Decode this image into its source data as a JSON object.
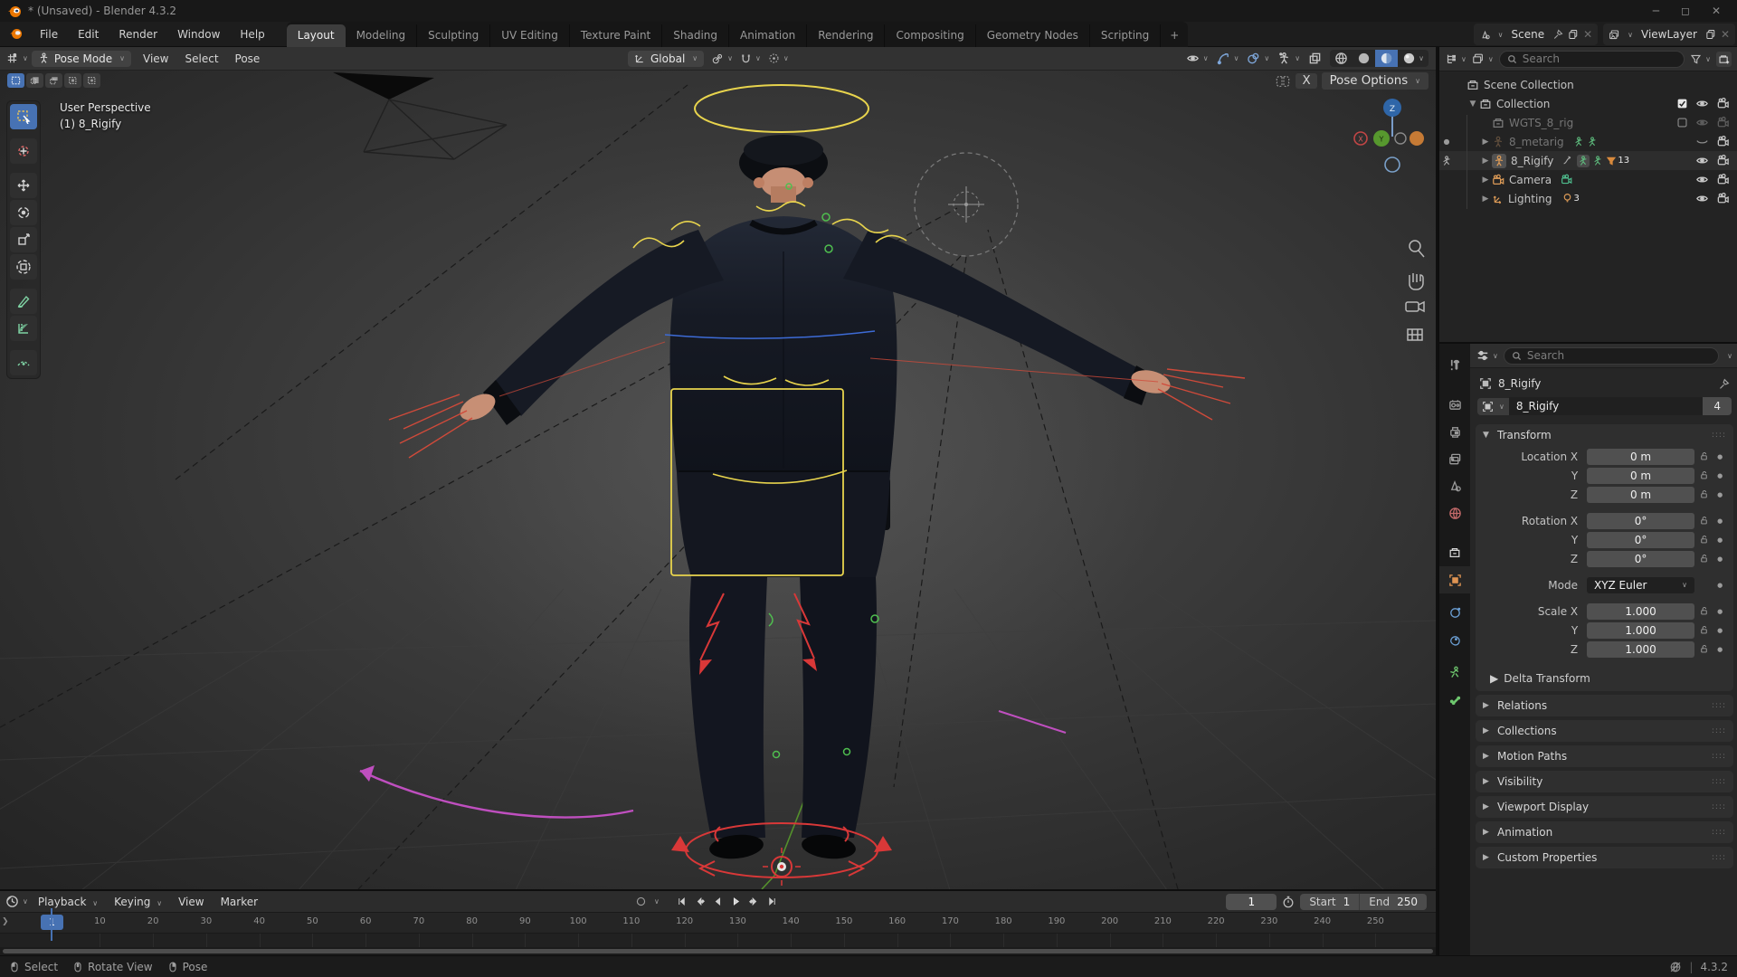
{
  "colors": {
    "accent": "#4772b3",
    "object_orange": "#e09553",
    "data_green": "#6ec76e",
    "rig_yellow": "#e8d44d",
    "rig_red": "#d93838",
    "rig_green": "#4fbf4f",
    "rig_magenta": "#bf4fbf",
    "axis_x": "#c94545",
    "axis_y": "#57982e",
    "axis_z": "#3f6fb8"
  },
  "window": {
    "title": "* (Unsaved) - Blender 4.3.2",
    "controls": [
      "minimize",
      "maximize",
      "close"
    ]
  },
  "topbar": {
    "menus": [
      "File",
      "Edit",
      "Render",
      "Window",
      "Help"
    ],
    "workspaces": [
      "Layout",
      "Modeling",
      "Sculpting",
      "UV Editing",
      "Texture Paint",
      "Shading",
      "Animation",
      "Rendering",
      "Compositing",
      "Geometry Nodes",
      "Scripting"
    ],
    "active_workspace": "Layout",
    "add_workspace": "+",
    "scene": {
      "icon": "scene-browse",
      "label": "Scene",
      "icons": [
        "pin",
        "copy",
        "close-x"
      ]
    },
    "viewlayer": {
      "icon": "viewlayer",
      "label": "ViewLayer",
      "icons": [
        "copy",
        "close-x"
      ]
    }
  },
  "viewport": {
    "header": {
      "editor_icon": "editor-3d",
      "mode_icon": "pose-figure",
      "mode": "Pose Mode",
      "menus": [
        "View",
        "Select",
        "Pose"
      ],
      "orientation": "Global",
      "center_icons": [
        "orientation",
        "pivot",
        "magnet",
        "proportional"
      ],
      "right_icons": [
        {
          "name": "visibility-eye",
          "active": false
        },
        {
          "name": "gizmo",
          "active": true
        },
        {
          "name": "overlays",
          "active": true
        },
        {
          "name": "xray-figure",
          "active": false
        },
        {
          "name": "xray-squares",
          "active": false,
          "caret": false
        }
      ],
      "shading_modes": [
        {
          "name": "wireframe",
          "active": false
        },
        {
          "name": "solid",
          "active": false
        },
        {
          "name": "material",
          "active": true
        },
        {
          "name": "rendered",
          "active": false,
          "caret": true
        }
      ],
      "select_modes": [
        "set",
        "extend",
        "subtract",
        "invert",
        "intersect"
      ],
      "mirror_icon": "butterfly",
      "mirror_x": "X",
      "pose_options": "Pose Options"
    },
    "overlay_text": [
      "User Perspective",
      "(1) 8_Rigify"
    ],
    "gizmo_axes": {
      "x": "X",
      "y": "Y",
      "z": "Z"
    },
    "nav_buttons": [
      "zoom",
      "hand",
      "camera",
      "grid"
    ],
    "tools": [
      "select-box",
      "cursor",
      "move",
      "rotate",
      "scale",
      "transform",
      "annotate",
      "measure",
      "breakdowner"
    ]
  },
  "outliner": {
    "header_icons": [
      "filter-tree",
      "display-mode"
    ],
    "search_placeholder": "Search",
    "right_icons": [
      "funnel",
      "new-collection"
    ],
    "rows": [
      {
        "label": "Scene Collection",
        "icon": "collection",
        "indent": 0,
        "expander": "",
        "gutter": "",
        "dim": false,
        "sel": false,
        "inline": [],
        "badge": "",
        "toggles": []
      },
      {
        "label": "Collection",
        "icon": "collection",
        "indent": 1,
        "expander": "down",
        "gutter": "",
        "dim": false,
        "sel": false,
        "inline": [],
        "badge": "",
        "toggles": [
          "checkbox-on",
          "eye",
          "camera"
        ]
      },
      {
        "label": "WGTS_8_rig",
        "icon": "collection",
        "indent": 2,
        "expander": "",
        "gutter": "",
        "dim": true,
        "sel": false,
        "inline": [],
        "badge": "",
        "toggles": [
          "checkbox-off",
          "eye-dim",
          "camera-x"
        ]
      },
      {
        "label": "8_metarig",
        "icon": "armature",
        "indent": 2,
        "expander": "right",
        "gutter": "dot",
        "dim": true,
        "sel": false,
        "inline": [
          "pose-figure-grn",
          "pose-figure-grn"
        ],
        "badge": "",
        "toggles": [
          "eye-closed",
          "camera"
        ]
      },
      {
        "label": "8_Rigify",
        "icon": "armature-boxed",
        "indent": 2,
        "expander": "right",
        "gutter": "figure",
        "dim": false,
        "sel": true,
        "inline": [
          "anim-curve",
          "pose-figure-boxed",
          "pose-figure-grn",
          "funnel-orange"
        ],
        "badge": "13",
        "toggles": [
          "eye",
          "camera"
        ]
      },
      {
        "label": "Camera",
        "icon": "camera-object",
        "indent": 2,
        "expander": "right",
        "gutter": "",
        "dim": false,
        "sel": false,
        "inline": [
          "camera-data"
        ],
        "badge": "",
        "toggles": [
          "eye",
          "camera"
        ]
      },
      {
        "label": "Lighting",
        "icon": "empty-axis",
        "indent": 2,
        "expander": "right",
        "gutter": "",
        "dim": false,
        "sel": false,
        "inline": [
          "light-bulb"
        ],
        "badge": "3",
        "toggles": [
          "eye",
          "camera"
        ]
      }
    ]
  },
  "properties": {
    "header_icon": "sliders",
    "search_placeholder": "Search",
    "tabs": [
      "tool",
      "render",
      "output",
      "view-layer",
      "scene",
      "world",
      "collection",
      "object",
      "constraints",
      "physics",
      "object-data",
      "bone"
    ],
    "active_tab": "object",
    "breadcrumb": "8_Rigify",
    "datablock": {
      "name": "8_Rigify",
      "users": "4"
    },
    "transform": {
      "title": "Transform",
      "groups": [
        [
          {
            "label": "Location X",
            "value": "0 m"
          },
          {
            "label": "Y",
            "value": "0 m"
          },
          {
            "label": "Z",
            "value": "0 m"
          }
        ],
        [
          {
            "label": "Rotation X",
            "value": "0°"
          },
          {
            "label": "Y",
            "value": "0°"
          },
          {
            "label": "Z",
            "value": "0°"
          }
        ],
        [
          {
            "label": "Mode",
            "value": "XYZ Euler",
            "dropdown": true
          }
        ],
        [
          {
            "label": "Scale X",
            "value": "1.000"
          },
          {
            "label": "Y",
            "value": "1.000"
          },
          {
            "label": "Z",
            "value": "1.000"
          }
        ]
      ],
      "subpanel": "Delta Transform"
    },
    "panels": [
      "Relations",
      "Collections",
      "Motion Paths",
      "Visibility",
      "Viewport Display",
      "Animation",
      "Custom Properties"
    ]
  },
  "timeline": {
    "editor_icon": "clock",
    "menus": [
      "Playback",
      "Keying",
      "View",
      "Marker"
    ],
    "record_icon": "record",
    "playback_icons": [
      "jump-start",
      "prev-key",
      "prev-frame",
      "play",
      "next-key",
      "jump-end"
    ],
    "current_frame": "1",
    "frame_field": "1",
    "start_label": "Start",
    "start_value": "1",
    "end_label": "End",
    "end_value": "250",
    "ticks": [
      10,
      20,
      30,
      40,
      50,
      60,
      70,
      80,
      90,
      100,
      110,
      120,
      130,
      140,
      150,
      160,
      170,
      180,
      190,
      200,
      210,
      220,
      230,
      240,
      250
    ]
  },
  "statusbar": {
    "items": [
      {
        "icon": "mouse-left",
        "label": "Select"
      },
      {
        "icon": "mouse-middle",
        "label": "Rotate View"
      },
      {
        "icon": "mouse-right",
        "label": "Pose"
      }
    ],
    "network_icon": "network-offline",
    "version": "4.3.2"
  }
}
